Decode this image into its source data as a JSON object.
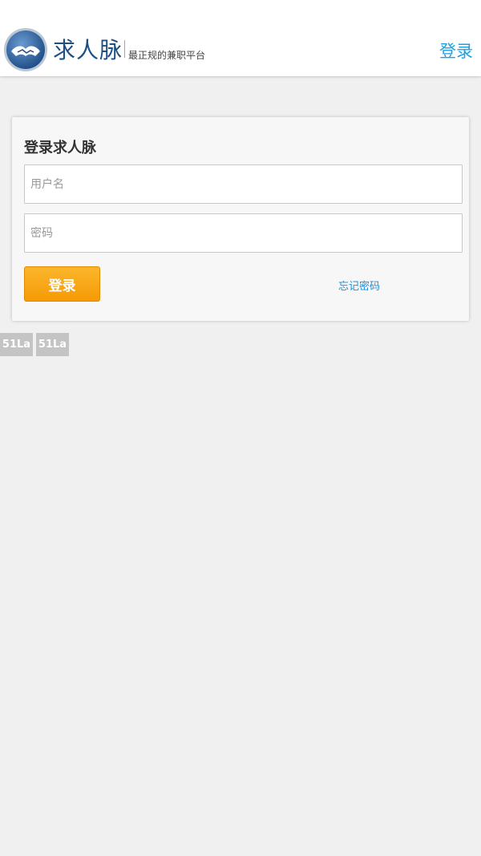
{
  "header": {
    "brand_name": "求人脉",
    "slogan": "最正规的兼职平台",
    "login_link": "登录"
  },
  "login_form": {
    "title": "登录求人脉",
    "username_placeholder": "用户名",
    "password_placeholder": "密码",
    "submit_label": "登录",
    "forgot_password": "忘记密码"
  },
  "badges": [
    "51La",
    "51La"
  ],
  "colors": {
    "brand_blue": "#1c4f86",
    "link_blue": "#1fa0e0",
    "button_orange": "#f7a516",
    "page_bg": "#f0f0f0"
  },
  "icons": {
    "logo": "handshake-globe-icon"
  }
}
